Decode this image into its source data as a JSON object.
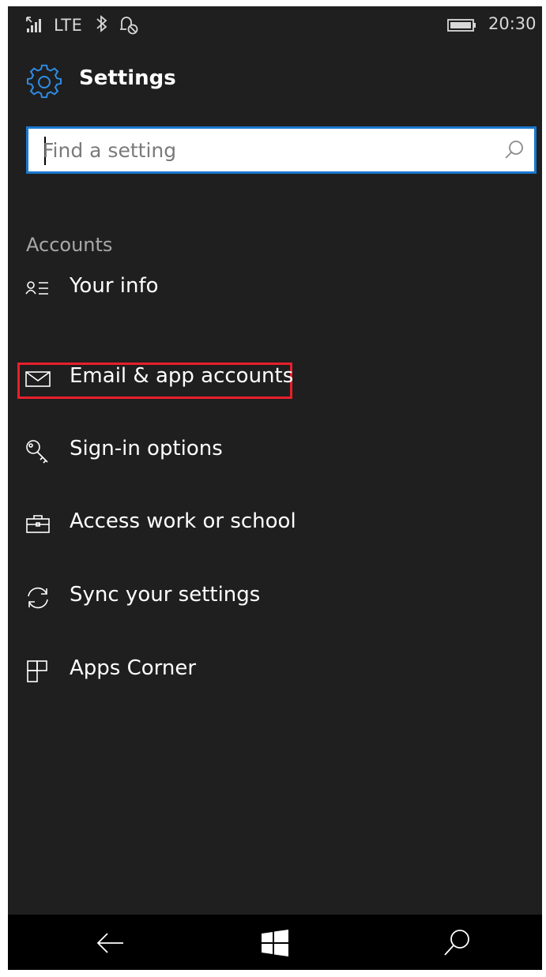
{
  "status_bar": {
    "network": "LTE",
    "time": "20:30",
    "icons": [
      "signal-icon",
      "bluetooth-icon",
      "quiet-hours-icon",
      "battery-icon"
    ]
  },
  "header": {
    "title": "Settings",
    "icon": "gear-icon"
  },
  "search": {
    "placeholder": "Find a setting",
    "value": ""
  },
  "section": {
    "label": "Accounts"
  },
  "items": [
    {
      "label": "Your info",
      "icon": "person-list-icon"
    },
    {
      "label": "Email & app accounts",
      "icon": "mail-icon",
      "highlighted": true
    },
    {
      "label": "Sign-in options",
      "icon": "key-icon"
    },
    {
      "label": "Access work or school",
      "icon": "briefcase-icon"
    },
    {
      "label": "Sync your settings",
      "icon": "sync-icon"
    },
    {
      "label": "Apps Corner",
      "icon": "apps-corner-icon"
    }
  ],
  "navbar": {
    "buttons": [
      "back-icon",
      "windows-start-icon",
      "search-icon"
    ]
  },
  "colors": {
    "background": "#1f1f1f",
    "accent": "#1a78d0",
    "highlight": "#e8202b",
    "navbar": "#000000"
  }
}
